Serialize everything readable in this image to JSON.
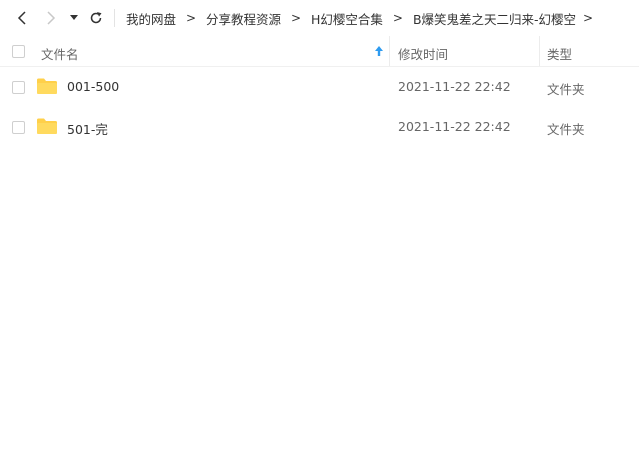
{
  "toolbar": {
    "back_icon": "chevron-left-icon",
    "forward_icon": "chevron-right-icon",
    "history_icon": "caret-down-icon",
    "refresh_icon": "refresh-icon"
  },
  "breadcrumb": {
    "items": [
      {
        "label": "我的网盘"
      },
      {
        "label": "分享教程资源"
      },
      {
        "label": "H幻樱空合集"
      },
      {
        "label": "B爆笑鬼差之天二归来-幻樱空"
      }
    ],
    "separator": ">"
  },
  "header": {
    "name_label": "文件名",
    "modified_label": "修改时间",
    "type_label": "类型",
    "sort_icon": "sort-arrow-up-icon"
  },
  "files": [
    {
      "name": "001-500",
      "modified": "2021-11-22 22:42",
      "type": "文件夹",
      "icon": "folder-icon"
    },
    {
      "name": "501-完",
      "modified": "2021-11-22 22:42",
      "type": "文件夹",
      "icon": "folder-icon"
    }
  ],
  "colors": {
    "folder": "#FFD04A",
    "sort_arrow": "#2E9BF0",
    "text": "#333333",
    "muted": "#666666"
  }
}
